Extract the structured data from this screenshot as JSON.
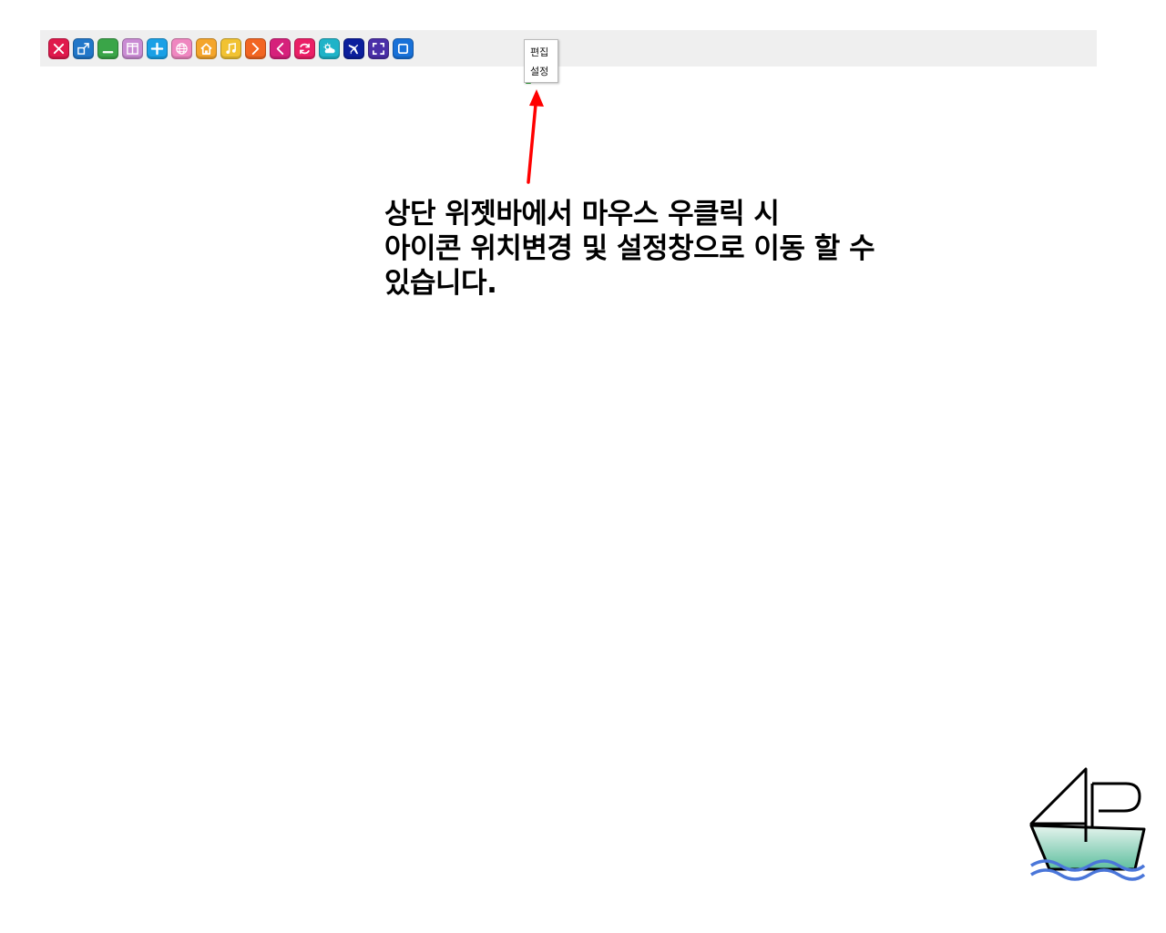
{
  "context_menu": {
    "items": [
      {
        "label": "편집"
      },
      {
        "label": "설정"
      }
    ]
  },
  "caption": {
    "lines": [
      "상단 위젯바에서 마우스 우클릭 시",
      "아이콘 위치변경 및 설정창으로 이동 할 수",
      "있습니다."
    ]
  },
  "widget_icons": [
    {
      "name": "close-icon",
      "color": "#e0194c"
    },
    {
      "name": "restore-window-icon",
      "color": "#2177c9"
    },
    {
      "name": "minimize-icon",
      "color": "#3aa548"
    },
    {
      "name": "split-view-icon",
      "color": "#c98bd3"
    },
    {
      "name": "plus-icon",
      "color": "#1aa0e6"
    },
    {
      "name": "globe-icon",
      "color": "#ef87c0"
    },
    {
      "name": "home-icon",
      "color": "#f4a52b"
    },
    {
      "name": "music-icon",
      "color": "#f1c232"
    },
    {
      "name": "chevron-right-icon",
      "color": "#f26522"
    },
    {
      "name": "chevron-left-icon",
      "color": "#d6217b"
    },
    {
      "name": "refresh-icon",
      "color": "#ea1f66"
    },
    {
      "name": "weather-icon",
      "color": "#1fb3c8"
    },
    {
      "name": "pin-icon",
      "color": "#0b1e9c"
    },
    {
      "name": "fullscreen-icon",
      "color": "#4b2fa8"
    },
    {
      "name": "window-icon",
      "color": "#1871d8"
    }
  ],
  "accent": {
    "arrow": "#ff0000",
    "widget_bar": "#efefef"
  }
}
